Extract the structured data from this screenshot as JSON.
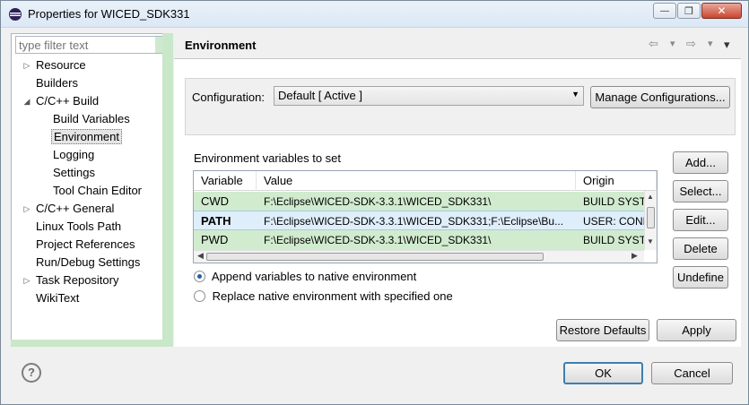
{
  "window": {
    "title": "Properties for WICED_SDK331",
    "minimize_label": "—",
    "restore_label": "❐",
    "close_label": "✕"
  },
  "filter": {
    "placeholder": "type filter text"
  },
  "tree": [
    {
      "label": "Resource",
      "expand": "▷"
    },
    {
      "label": "Builders",
      "expand": ""
    },
    {
      "label": "C/C++ Build",
      "expand": "◢"
    },
    {
      "label": "Build Variables",
      "expand": ""
    },
    {
      "label": "Environment",
      "expand": ""
    },
    {
      "label": "Logging",
      "expand": ""
    },
    {
      "label": "Settings",
      "expand": ""
    },
    {
      "label": "Tool Chain Editor",
      "expand": ""
    },
    {
      "label": "C/C++ General",
      "expand": "▷"
    },
    {
      "label": "Linux Tools Path",
      "expand": ""
    },
    {
      "label": "Project References",
      "expand": ""
    },
    {
      "label": "Run/Debug Settings",
      "expand": ""
    },
    {
      "label": "Task Repository",
      "expand": "▷"
    },
    {
      "label": "WikiText",
      "expand": ""
    }
  ],
  "page": {
    "title": "Environment",
    "nav_back": "⇦",
    "nav_forward": "⇨",
    "nav_down": "▾",
    "menu": "▾"
  },
  "config": {
    "label": "Configuration:",
    "value": "Default  [ Active ]",
    "dropdown_arrow": "▼",
    "manage_button": "Manage Configurations..."
  },
  "env": {
    "label": "Environment variables to set",
    "columns": [
      "Variable",
      "Value",
      "Origin"
    ],
    "rows": [
      {
        "variable": "CWD",
        "value": "F:\\Eclipse\\WICED-SDK-3.3.1\\WICED_SDK331\\",
        "origin": "BUILD SYSTEM"
      },
      {
        "variable": "PATH",
        "value": "F:\\Eclipse\\WICED-SDK-3.3.1\\WICED_SDK331;F:\\Eclipse\\Bu...",
        "origin": "USER: CONFIG"
      },
      {
        "variable": "PWD",
        "value": "F:\\Eclipse\\WICED-SDK-3.3.1\\WICED_SDK331\\",
        "origin": "BUILD SYSTEM"
      }
    ],
    "buttons": {
      "add": "Add...",
      "select": "Select...",
      "edit": "Edit...",
      "delete": "Delete",
      "undefine": "Undefine"
    },
    "append_option": "Append variables to native environment",
    "replace_option": "Replace native environment with specified one"
  },
  "actions": {
    "restore_defaults": "Restore Defaults",
    "apply": "Apply"
  },
  "footer": {
    "help": "?",
    "ok": "OK",
    "cancel": "Cancel"
  },
  "colors": {
    "accent_green": "#c9e7c9",
    "selection_blue": "#dfeefb",
    "row_green": "#d1ebcf"
  }
}
